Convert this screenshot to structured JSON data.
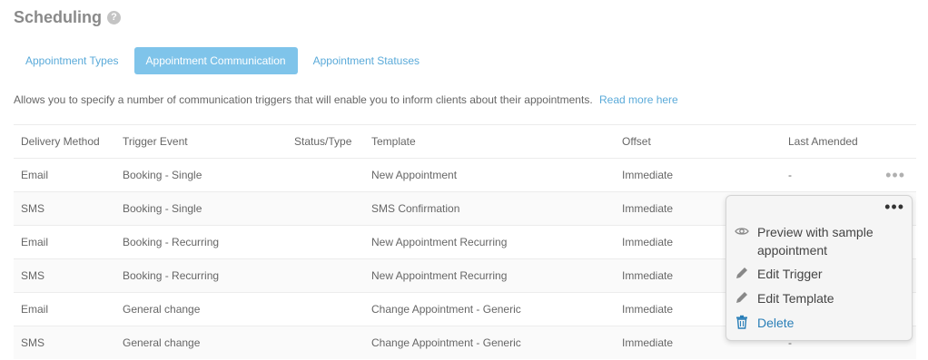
{
  "page": {
    "title": "Scheduling",
    "help_glyph": "?",
    "description": "Allows you to specify a number of communication triggers that will enable you to inform clients about their appointments.",
    "read_more": "Read more here"
  },
  "tabs": [
    {
      "label": "Appointment Types",
      "active": false
    },
    {
      "label": "Appointment Communication",
      "active": true
    },
    {
      "label": "Appointment Statuses",
      "active": false
    }
  ],
  "table": {
    "columns": [
      "Delivery Method",
      "Trigger Event",
      "Status/Type",
      "Template",
      "Offset",
      "Last Amended"
    ],
    "rows": [
      [
        "Email",
        "Booking - Single",
        "",
        "New Appointment",
        "Immediate",
        "-"
      ],
      [
        "SMS",
        "Booking - Single",
        "",
        "SMS Confirmation",
        "Immediate",
        ""
      ],
      [
        "Email",
        "Booking - Recurring",
        "",
        "New Appointment Recurring",
        "Immediate",
        ""
      ],
      [
        "SMS",
        "Booking - Recurring",
        "",
        "New Appointment Recurring",
        "Immediate",
        ""
      ],
      [
        "Email",
        "General change",
        "",
        "Change Appointment - Generic",
        "Immediate",
        ""
      ],
      [
        "SMS",
        "General change",
        "",
        "Change Appointment - Generic",
        "Immediate",
        "-"
      ]
    ],
    "more_glyph": "•••"
  },
  "menu": {
    "dots": "•••",
    "items": [
      {
        "label": "Preview with sample appointment",
        "icon": "eye-icon"
      },
      {
        "label": "Edit Trigger",
        "icon": "pencil-icon"
      },
      {
        "label": "Edit Template",
        "icon": "pencil-icon"
      },
      {
        "label": "Delete",
        "icon": "trash-icon"
      }
    ]
  },
  "colors": {
    "accent": "#5aaad9",
    "active_tab": "#7fc4ea",
    "delete": "#2a7fb8"
  }
}
